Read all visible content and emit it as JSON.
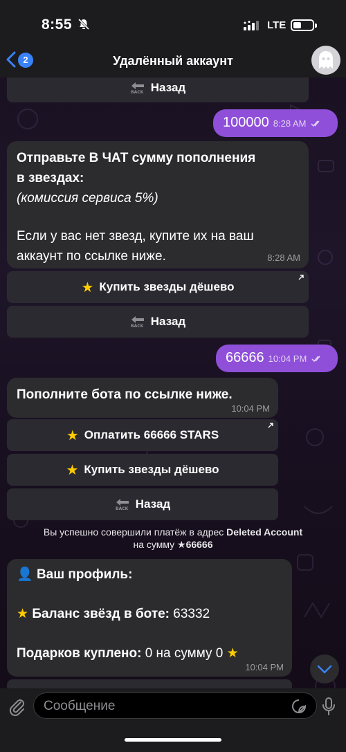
{
  "status": {
    "time": "8:55",
    "network": "LTE"
  },
  "nav": {
    "back_count": "2",
    "title": "Удалённый аккаунт"
  },
  "messages": {
    "top_back": {
      "label": "Назад"
    },
    "out1": {
      "text": "100000",
      "time": "8:28 AM"
    },
    "in1": {
      "line1": "Отправьте В ЧАТ сумму пополнения",
      "line2": "в звездах:",
      "line3": "(комиссия сервиса 5%)",
      "line4": "Если у вас нет звезд, купите их на ваш",
      "line5": "аккаунт по ссылке ниже.",
      "time": "8:28 AM"
    },
    "in1_buttons": {
      "buy": "Купить звезды дёшево",
      "back": "Назад"
    },
    "out2": {
      "text": "66666",
      "time": "10:04 PM"
    },
    "in2": {
      "text": "Пополните бота по ссылке ниже.",
      "time": "10:04 PM"
    },
    "in2_buttons": {
      "pay": "Оплатить 66666 STARS",
      "buy": "Купить звезды дёшево",
      "back": "Назад"
    },
    "service": {
      "part1": "Вы успешно совершили платёж в адрес ",
      "name": "Deleted Account",
      "part2": " на сумму ",
      "amount": "66666"
    },
    "profile": {
      "title": "Ваш профиль:",
      "balance_label": "Баланс звёзд в боте:",
      "balance_value": "63332",
      "gifts_label": "Подарков куплено:",
      "gifts_value": "0 на сумму 0",
      "time": "10:04 PM"
    }
  },
  "input": {
    "placeholder": "Сообщение"
  },
  "colors": {
    "outgoing_bubble": "#8f4fd9",
    "incoming_bubble": "#2c2c2e",
    "accent": "#3a82f7"
  }
}
